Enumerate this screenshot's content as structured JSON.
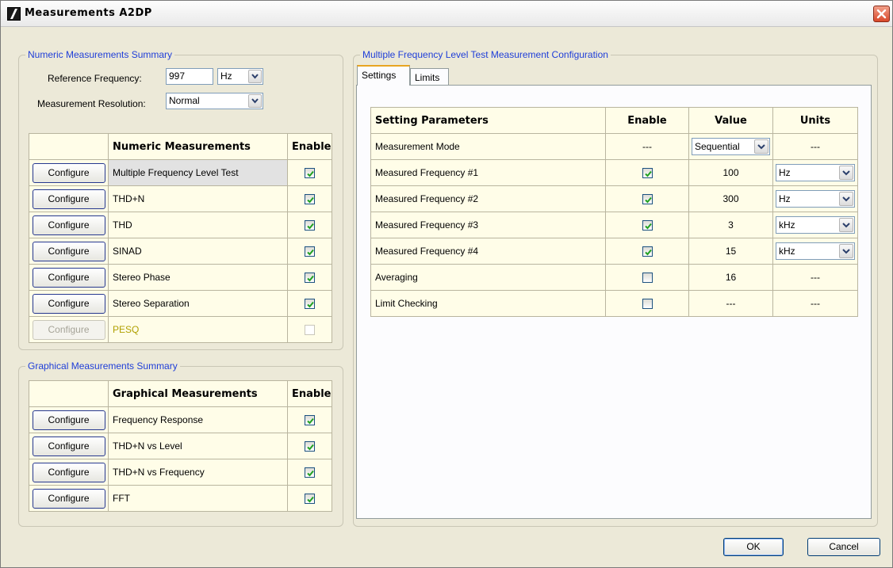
{
  "window": {
    "title": "Measurements A2DP",
    "icon": "app-logo-icon",
    "close_icon": "close-icon"
  },
  "numeric_summary": {
    "legend": "Numeric Measurements Summary",
    "ref_freq_label": "Reference Frequency:",
    "ref_freq_value": "997",
    "ref_freq_unit": "Hz",
    "resolution_label": "Measurement Resolution:",
    "resolution_value": "Normal",
    "table": {
      "headers": [
        "",
        "Numeric Measurements",
        "Enable"
      ],
      "rows": [
        {
          "button": "Configure",
          "name": "Multiple Frequency Level Test",
          "enabled": true,
          "disabled": false,
          "selected": true
        },
        {
          "button": "Configure",
          "name": "THD+N",
          "enabled": true,
          "disabled": false,
          "selected": false
        },
        {
          "button": "Configure",
          "name": "THD",
          "enabled": true,
          "disabled": false,
          "selected": false
        },
        {
          "button": "Configure",
          "name": "SINAD",
          "enabled": true,
          "disabled": false,
          "selected": false
        },
        {
          "button": "Configure",
          "name": "Stereo Phase",
          "enabled": true,
          "disabled": false,
          "selected": false
        },
        {
          "button": "Configure",
          "name": "Stereo Separation",
          "enabled": true,
          "disabled": false,
          "selected": false
        },
        {
          "button": "Configure",
          "name": "PESQ",
          "enabled": false,
          "disabled": true,
          "selected": false
        }
      ]
    }
  },
  "graphical_summary": {
    "legend": "Graphical Measurements Summary",
    "table": {
      "headers": [
        "",
        "Graphical Measurements",
        "Enable"
      ],
      "rows": [
        {
          "button": "Configure",
          "name": "Frequency Response",
          "enabled": true
        },
        {
          "button": "Configure",
          "name": "THD+N vs Level",
          "enabled": true
        },
        {
          "button": "Configure",
          "name": "THD+N vs Frequency",
          "enabled": true
        },
        {
          "button": "Configure",
          "name": "FFT",
          "enabled": true
        }
      ]
    }
  },
  "config": {
    "legend": "Multiple Frequency Level Test Measurement Configuration",
    "tabs": [
      {
        "label": "Settings",
        "active": true
      },
      {
        "label": "Limits",
        "active": false
      }
    ],
    "table": {
      "headers": [
        "Setting Parameters",
        "Enable",
        "Value",
        "Units"
      ],
      "rows": [
        {
          "param": "Measurement Mode",
          "enable": "---",
          "value": "Sequential",
          "value_is_combo": true,
          "units": "---",
          "units_is_combo": false
        },
        {
          "param": "Measured Frequency #1",
          "enable": true,
          "value": "100",
          "value_is_combo": false,
          "units": "Hz",
          "units_is_combo": true
        },
        {
          "param": "Measured Frequency #2",
          "enable": true,
          "value": "300",
          "value_is_combo": false,
          "units": "Hz",
          "units_is_combo": true
        },
        {
          "param": "Measured Frequency #3",
          "enable": true,
          "value": "3",
          "value_is_combo": false,
          "units": "kHz",
          "units_is_combo": true
        },
        {
          "param": "Measured Frequency #4",
          "enable": true,
          "value": "15",
          "value_is_combo": false,
          "units": "kHz",
          "units_is_combo": true
        },
        {
          "param": "Averaging",
          "enable": false,
          "value": "16",
          "value_is_combo": false,
          "units": "---",
          "units_is_combo": false
        },
        {
          "param": "Limit Checking",
          "enable": false,
          "value": "---",
          "value_is_combo": false,
          "units": "---",
          "units_is_combo": false
        }
      ]
    }
  },
  "buttons": {
    "ok": "OK",
    "cancel": "Cancel"
  },
  "colors": {
    "legend_text": "#1f3ed8",
    "cell_bg": "#fffde8",
    "window_bg": "#ece9d8",
    "tab_accent": "#e8a521",
    "disabled_text": "#b0a000"
  }
}
